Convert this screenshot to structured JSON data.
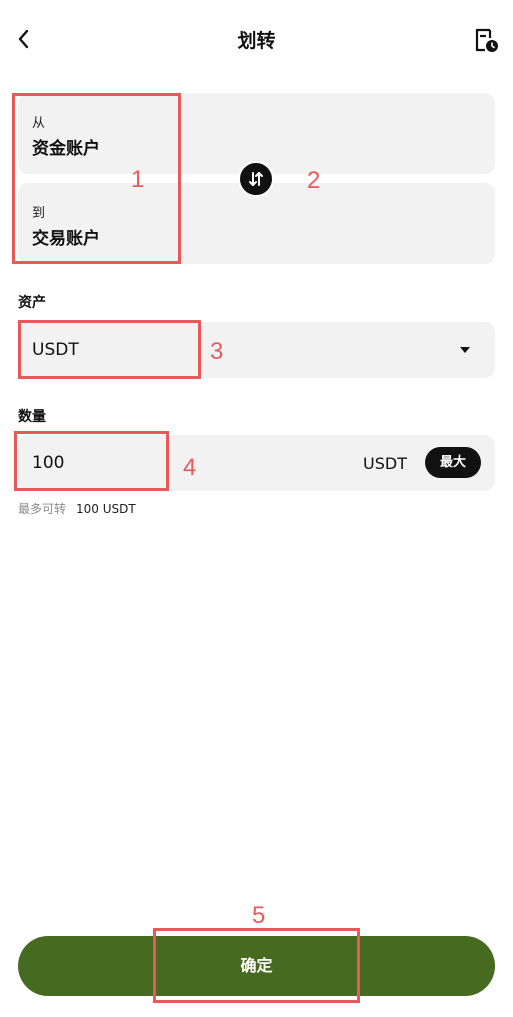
{
  "header": {
    "title": "划转",
    "back_icon": "chevron-left-icon",
    "history_icon": "document-clock-icon"
  },
  "transfer": {
    "from_label": "从",
    "from_value": "资金账户",
    "to_label": "到",
    "to_value": "交易账户",
    "swap_icon": "swap-vertical-icon"
  },
  "asset": {
    "label": "资产",
    "value": "USDT",
    "dropdown_icon": "caret-down-icon"
  },
  "quantity": {
    "label": "数量",
    "value": "100",
    "unit": "USDT",
    "max_label": "最大"
  },
  "available": {
    "label": "最多可转",
    "value": "100 USDT"
  },
  "confirm": {
    "label": "确定"
  },
  "annotations": [
    "1",
    "2",
    "3",
    "4",
    "5"
  ],
  "colors": {
    "primary_button": "#466b20",
    "card_background": "#f2f2f2",
    "annotation": "#e85a5a"
  }
}
